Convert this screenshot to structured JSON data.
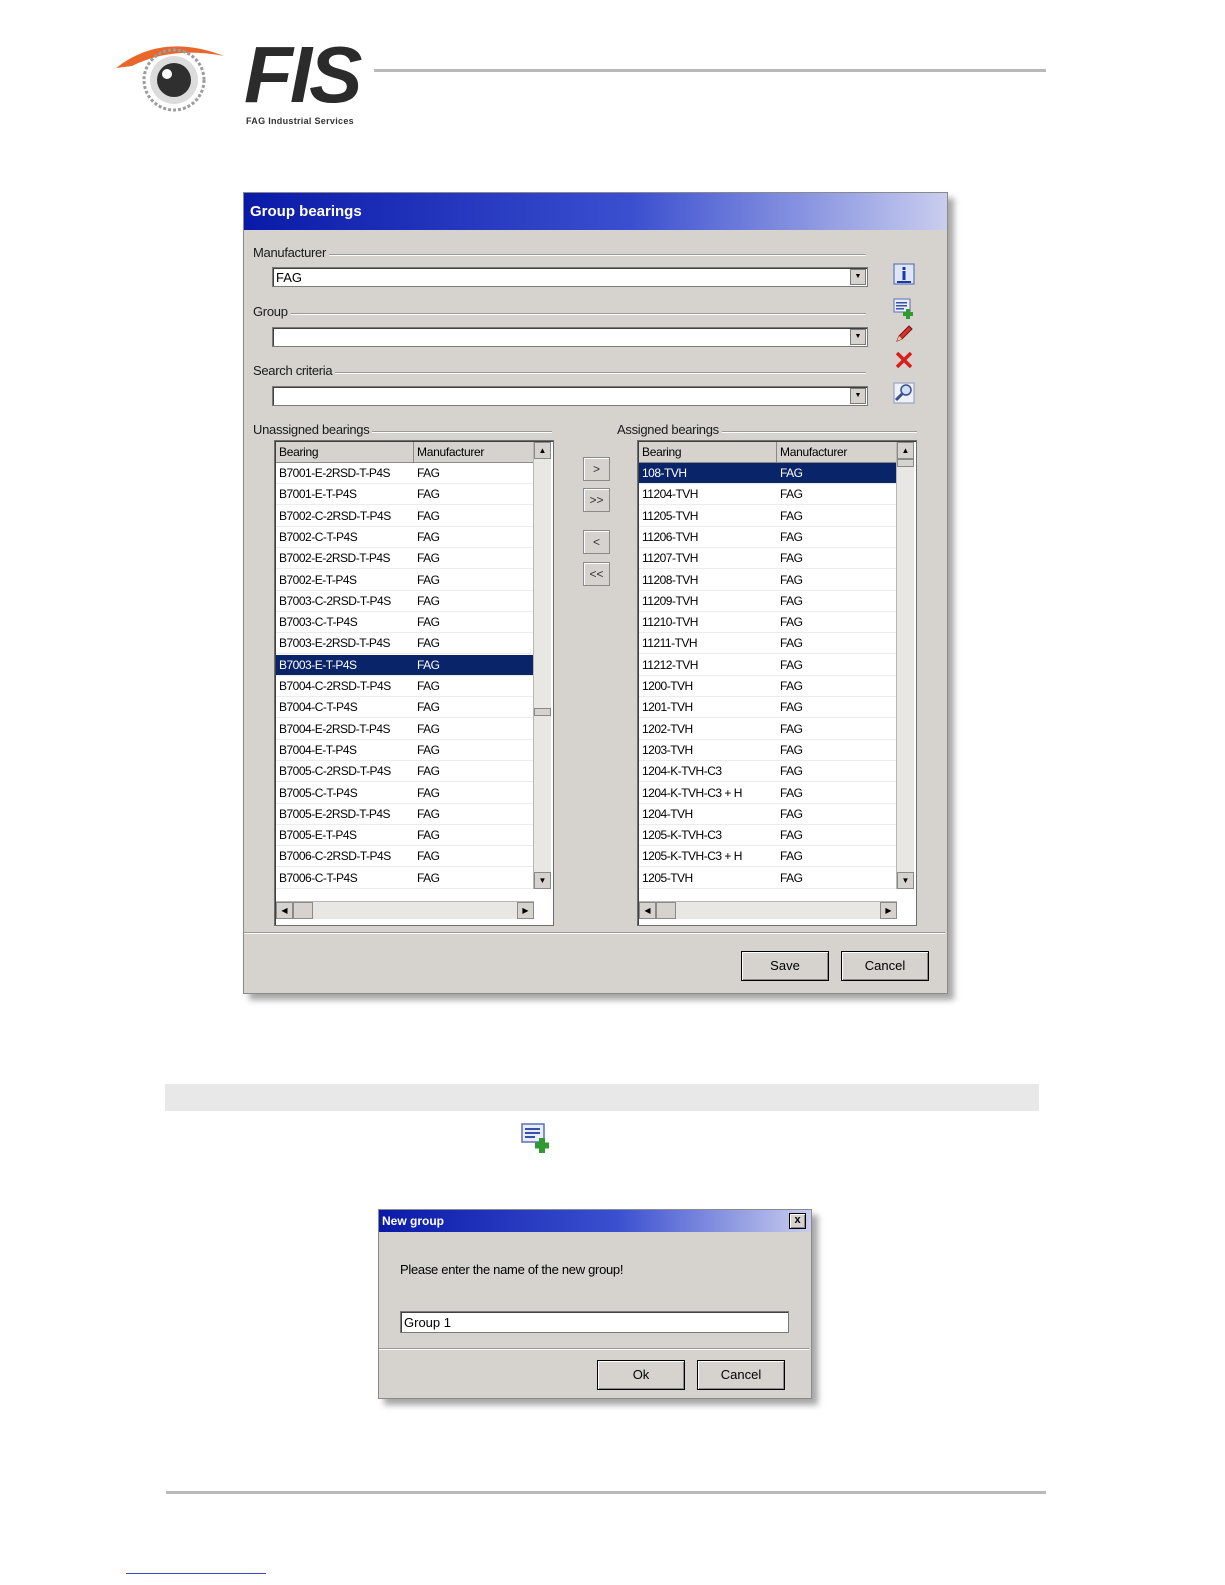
{
  "header": {
    "logo_text": "FIS",
    "logo_subtitle": "FAG Industrial Services",
    "logo_color": "#e8672a"
  },
  "group_dialog": {
    "title": "Group bearings",
    "manufacturer": {
      "label": "Manufacturer",
      "value": "FAG"
    },
    "group": {
      "label": "Group",
      "value": ""
    },
    "search": {
      "label": "Search criteria",
      "value": ""
    },
    "toolbar_icons": [
      "info-icon",
      "add-group-icon",
      "edit-pen-icon",
      "delete-x-icon",
      "search-magnifier-icon"
    ],
    "unassigned": {
      "label": "Unassigned bearings",
      "columns": [
        "Bearing",
        "Manufacturer"
      ],
      "rows": [
        [
          "B7001-E-2RSD-T-P4S",
          "FAG"
        ],
        [
          "B7001-E-T-P4S",
          "FAG"
        ],
        [
          "B7002-C-2RSD-T-P4S",
          "FAG"
        ],
        [
          "B7002-C-T-P4S",
          "FAG"
        ],
        [
          "B7002-E-2RSD-T-P4S",
          "FAG"
        ],
        [
          "B7002-E-T-P4S",
          "FAG"
        ],
        [
          "B7003-C-2RSD-T-P4S",
          "FAG"
        ],
        [
          "B7003-C-T-P4S",
          "FAG"
        ],
        [
          "B7003-E-2RSD-T-P4S",
          "FAG"
        ],
        [
          "B7003-E-T-P4S",
          "FAG"
        ],
        [
          "B7004-C-2RSD-T-P4S",
          "FAG"
        ],
        [
          "B7004-C-T-P4S",
          "FAG"
        ],
        [
          "B7004-E-2RSD-T-P4S",
          "FAG"
        ],
        [
          "B7004-E-T-P4S",
          "FAG"
        ],
        [
          "B7005-C-2RSD-T-P4S",
          "FAG"
        ],
        [
          "B7005-C-T-P4S",
          "FAG"
        ],
        [
          "B7005-E-2RSD-T-P4S",
          "FAG"
        ],
        [
          "B7005-E-T-P4S",
          "FAG"
        ],
        [
          "B7006-C-2RSD-T-P4S",
          "FAG"
        ],
        [
          "B7006-C-T-P4S",
          "FAG"
        ]
      ],
      "selected_index": 9
    },
    "assigned": {
      "label": "Assigned bearings",
      "columns": [
        "Bearing",
        "Manufacturer"
      ],
      "rows": [
        [
          "108-TVH",
          "FAG"
        ],
        [
          "11204-TVH",
          "FAG"
        ],
        [
          "11205-TVH",
          "FAG"
        ],
        [
          "11206-TVH",
          "FAG"
        ],
        [
          "11207-TVH",
          "FAG"
        ],
        [
          "11208-TVH",
          "FAG"
        ],
        [
          "11209-TVH",
          "FAG"
        ],
        [
          "11210-TVH",
          "FAG"
        ],
        [
          "11211-TVH",
          "FAG"
        ],
        [
          "11212-TVH",
          "FAG"
        ],
        [
          "1200-TVH",
          "FAG"
        ],
        [
          "1201-TVH",
          "FAG"
        ],
        [
          "1202-TVH",
          "FAG"
        ],
        [
          "1203-TVH",
          "FAG"
        ],
        [
          "1204-K-TVH-C3",
          "FAG"
        ],
        [
          "1204-K-TVH-C3 + H",
          "FAG"
        ],
        [
          "1204-TVH",
          "FAG"
        ],
        [
          "1205-K-TVH-C3",
          "FAG"
        ],
        [
          "1205-K-TVH-C3 + H",
          "FAG"
        ],
        [
          "1205-TVH",
          "FAG"
        ]
      ],
      "selected_index": 0
    },
    "move_buttons": [
      ">",
      ">>",
      "<",
      "<<"
    ],
    "save_label": "Save",
    "cancel_label": "Cancel"
  },
  "new_group_dialog": {
    "title": "New group",
    "close_label": "x",
    "prompt": "Please enter the name of the new group!",
    "input_value": "Group 1",
    "ok_label": "Ok",
    "cancel_label": "Cancel"
  }
}
